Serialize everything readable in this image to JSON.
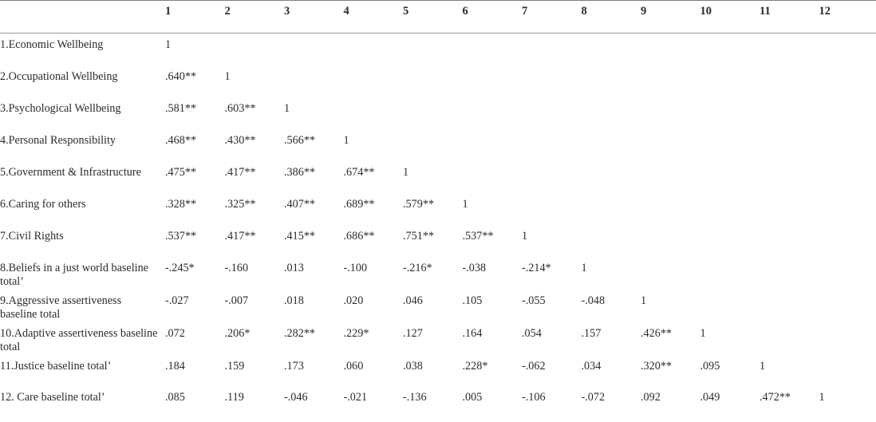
{
  "table": {
    "row_label_header": "",
    "column_headers": [
      "1",
      "2",
      "3",
      "4",
      "5",
      "6",
      "7",
      "8",
      "9",
      "10",
      "11",
      "12"
    ],
    "rows": [
      {
        "label": "1.Economic Wellbeing",
        "values": [
          "1",
          "",
          "",
          "",
          "",
          "",
          "",
          "",
          "",
          "",
          "",
          ""
        ]
      },
      {
        "label": "2.Occupational Wellbeing",
        "values": [
          ".640**",
          "1",
          "",
          "",
          "",
          "",
          "",
          "",
          "",
          "",
          "",
          ""
        ]
      },
      {
        "label": "3.Psychological Wellbeing",
        "values": [
          ".581**",
          ".603**",
          "1",
          "",
          "",
          "",
          "",
          "",
          "",
          "",
          "",
          ""
        ]
      },
      {
        "label": "4.Personal Responsibility",
        "values": [
          ".468**",
          ".430**",
          ".566**",
          "1",
          "",
          "",
          "",
          "",
          "",
          "",
          "",
          ""
        ]
      },
      {
        "label": "5.Government & Infrastructure",
        "values": [
          ".475**",
          ".417**",
          ".386**",
          ".674**",
          "1",
          "",
          "",
          "",
          "",
          "",
          "",
          ""
        ]
      },
      {
        "label": "6.Caring for others",
        "values": [
          ".328**",
          ".325**",
          ".407**",
          ".689**",
          ".579**",
          "1",
          "",
          "",
          "",
          "",
          "",
          ""
        ]
      },
      {
        "label": "7.Civil Rights",
        "values": [
          ".537**",
          ".417**",
          ".415**",
          ".686**",
          ".751**",
          ".537**",
          "1",
          "",
          "",
          "",
          "",
          ""
        ]
      },
      {
        "label": "8.Beliefs in a just world baseline total’",
        "values": [
          "-.245*",
          "-.160",
          ".013",
          "-.100",
          "-.216*",
          "-.038",
          "-.214*",
          "1",
          "",
          "",
          "",
          ""
        ]
      },
      {
        "label": "9.Aggressive assertiveness baseline total",
        "values": [
          "-.027",
          "-.007",
          ".018",
          ".020",
          ".046",
          ".105",
          "-.055",
          "-.048",
          "1",
          "",
          "",
          ""
        ]
      },
      {
        "label": "10.Adaptive assertiveness baseline total",
        "values": [
          ".072",
          ".206*",
          ".282**",
          ".229*",
          ".127",
          ".164",
          ".054",
          ".157",
          ".426**",
          "1",
          "",
          ""
        ]
      },
      {
        "label": "11.Justice baseline total’",
        "values": [
          ".184",
          ".159",
          ".173",
          ".060",
          ".038",
          ".228*",
          "-.062",
          ".034",
          ".320**",
          ".095",
          "1",
          ""
        ]
      },
      {
        "label": "12. Care baseline total’",
        "values": [
          ".085",
          ".119",
          "-.046",
          "-.021",
          "-.136",
          ".005",
          "-.106",
          "-.072",
          ".092",
          ".049",
          ".472**",
          "1"
        ]
      }
    ]
  }
}
